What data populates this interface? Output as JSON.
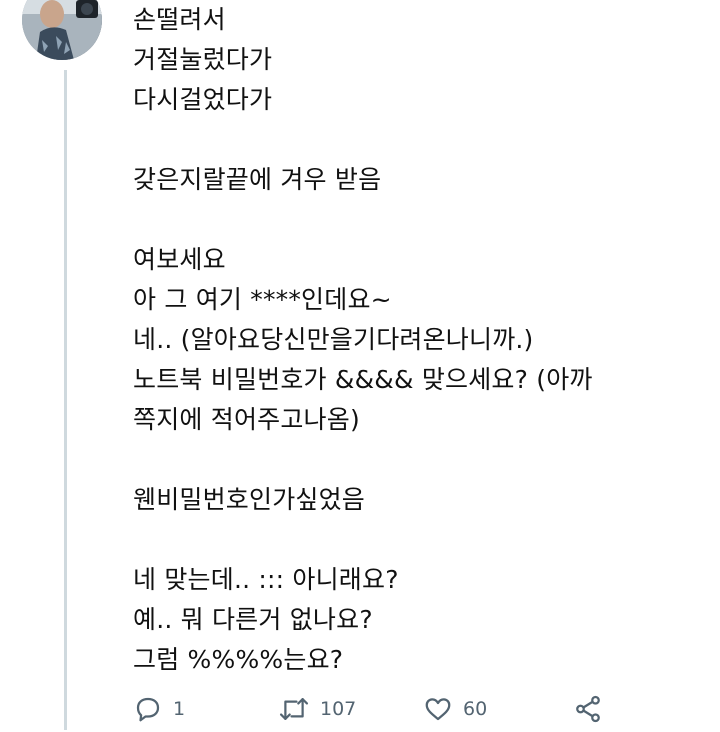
{
  "tweet": {
    "lines": [
      "손떨려서",
      "거절눌렀다가",
      "다시걸었다가",
      "",
      "갖은지랄끝에 겨우 받음",
      "",
      "여보세요",
      "아 그 여기 ****인데요~",
      "네.. (알아요당신만을기다려온나니까.)",
      "노트북 비밀번호가 &&&& 맞으세요? (아까",
      "쪽지에 적어주고나옴)",
      "",
      "웬비밀번호인가싶었음",
      "",
      "네 맞는데.. ::: 아니래요?",
      "예.. 뭐 다른거 없나요?",
      "그럼 %%%%는요?"
    ]
  },
  "actions": {
    "reply_count": "1",
    "retweet_count": "107",
    "like_count": "60"
  },
  "icons": {
    "reply": "reply-icon",
    "retweet": "retweet-icon",
    "like": "heart-icon",
    "share": "share-icon"
  },
  "colors": {
    "text": "#111111",
    "secondary": "#536471",
    "thread_line": "#cfd9de"
  }
}
